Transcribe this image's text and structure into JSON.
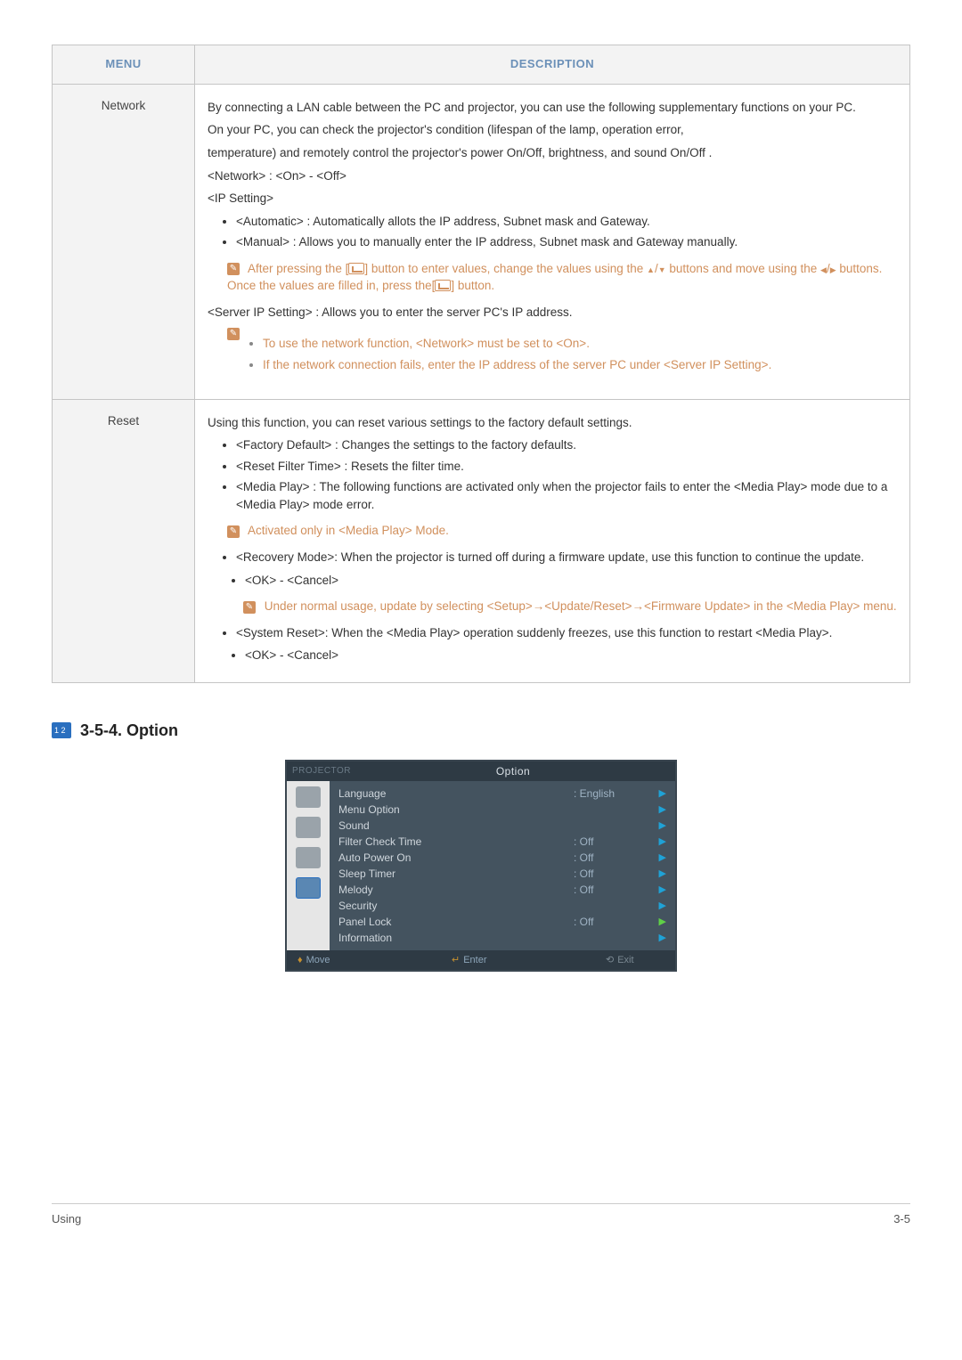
{
  "table_headers": {
    "menu": "MENU",
    "description": "DESCRIPTION"
  },
  "rows": [
    {
      "label": "Network",
      "p1": "By connecting a LAN cable between the PC and projector, you can use the following supplementary functions on your PC.",
      "p2": "On your PC, you can check the projector's condition (lifespan of the lamp, operation error,",
      "p3": "temperature) and remotely control the projector's power On/Off, brightness, and sound On/Off .",
      "p4": "<Network> : <On> - <Off>",
      "p5": "<IP Setting>",
      "bullets1": [
        "<Automatic> : Automatically allots the IP address, Subnet mask and Gateway.",
        "<Manual> : Allows you to manually enter the IP address, Subnet mask and Gateway manually."
      ],
      "note1_a": "After pressing the [",
      "note1_b": "] button to enter values, change the values using the ",
      "note1_c": " buttons and move using the ",
      "note1_d": " buttons. Once the values are filled in, press the[",
      "note1_e": "] button.",
      "p6": "<Server IP Setting> : Allows you to enter the server PC's IP address.",
      "note2_items": [
        "To use the network function, <Network> must be set to <On>.",
        "If the network connection fails, enter the IP address of the server PC under <Server IP Setting>."
      ]
    },
    {
      "label": "Reset",
      "p1": "Using this function, you can reset various settings to the factory default settings.",
      "bullets1": [
        "<Factory Default> : Changes the settings to the factory defaults.",
        "<Reset Filter Time> : Resets the filter time.",
        "<Media Play> : The following functions are activated only when the projector fails to enter the <Media Play> mode due to a <Media Play> mode error."
      ],
      "note1": "Activated only in <Media Play> Mode.",
      "bullets2_item": "<Recovery Mode>: When the projector is turned off during a firmware update, use this function to continue the update.",
      "bullets2_sub": "<OK> - <Cancel>",
      "note2": "Under normal usage, update by selecting <Setup>→<Update/Reset>→<Firmware Update> in the <Media Play> menu.",
      "bullets3_item": "<System Reset>: When the <Media Play> operation suddenly freezes, use this function to restart <Media Play>.",
      "bullets3_sub": "<OK> - <Cancel>"
    }
  ],
  "section": {
    "title": "3-5-4. Option"
  },
  "osd": {
    "projector_label": "PROJECTOR",
    "title": "Option",
    "rows": [
      {
        "label": "Language",
        "value": ": English"
      },
      {
        "label": "Menu Option",
        "value": ""
      },
      {
        "label": "Sound",
        "value": ""
      },
      {
        "label": "Filter Check Time",
        "value": ": Off"
      },
      {
        "label": "Auto Power On",
        "value": ": Off"
      },
      {
        "label": "Sleep Timer",
        "value": ": Off"
      },
      {
        "label": "Melody",
        "value": ": Off"
      },
      {
        "label": "Security",
        "value": ""
      },
      {
        "label": "Panel Lock",
        "value": ": Off",
        "hl": true
      },
      {
        "label": "Information",
        "value": ""
      }
    ],
    "footer": {
      "move": "Move",
      "enter": "Enter",
      "exit": "Exit"
    }
  },
  "page_footer": {
    "left": "Using",
    "right": "3-5"
  }
}
